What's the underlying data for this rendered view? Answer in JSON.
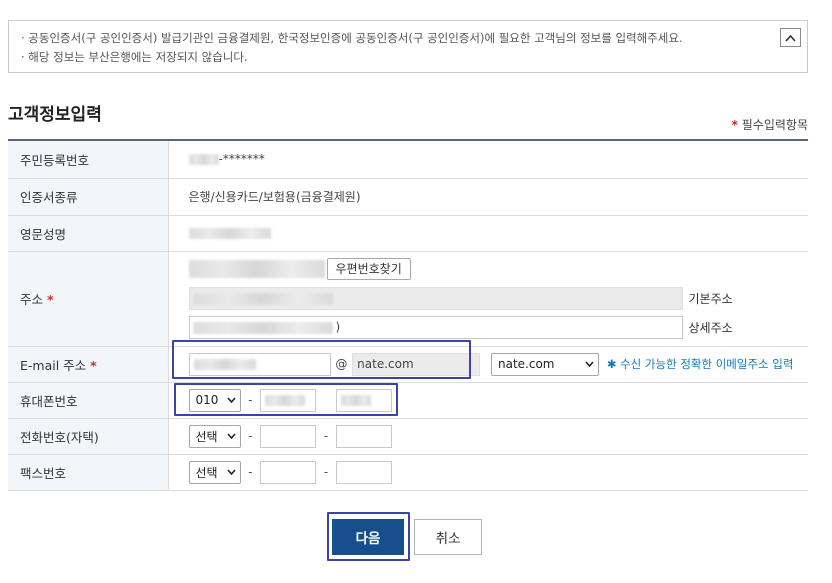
{
  "notice": {
    "line1": "· 공동인증서(구 공인인증서) 발급기관인 금융결제원, 한국정보인증에 공동인증서(구 공인인증서)에 필요한 고객님의 정보를 입력해주세요.",
    "line2": "· 해당 정보는 부산은행에는 저장되지 않습니다."
  },
  "section": {
    "title": "고객정보입력",
    "required_star": "*",
    "required_note": "필수입력항목"
  },
  "form": {
    "rrn": {
      "label": "주민등록번호",
      "masked_suffix": "-*******"
    },
    "cert_type": {
      "label": "인증서종류",
      "value": "은행/신용카드/보험용(금융결제원)"
    },
    "eng_name": {
      "label": "영문성명"
    },
    "address": {
      "label": "주소",
      "star": "*",
      "zip_button": "우편번호찾기",
      "base_label": "기본주소",
      "detail_label": "상세주소",
      "detail_suffix": ")"
    },
    "email": {
      "label": "E-mail 주소",
      "star": "*",
      "at": "@",
      "domain_value": "nate.com",
      "domain_select": "nate.com",
      "hint": "✱ 수신 가능한 정확한 이메일주소 입력"
    },
    "mobile": {
      "label": "휴대폰번호",
      "prefix": "010",
      "dash": "-"
    },
    "home_phone": {
      "label": "전화번호(자택)",
      "prefix": "선택",
      "dash": "-"
    },
    "fax": {
      "label": "팩스번호",
      "prefix": "선택",
      "dash": "-"
    }
  },
  "buttons": {
    "next": "다음",
    "cancel": "취소"
  },
  "colors": {
    "primary": "#174f8e",
    "highlight": "#3a43a6",
    "required": "#d2272b",
    "hint": "#1479b8"
  }
}
